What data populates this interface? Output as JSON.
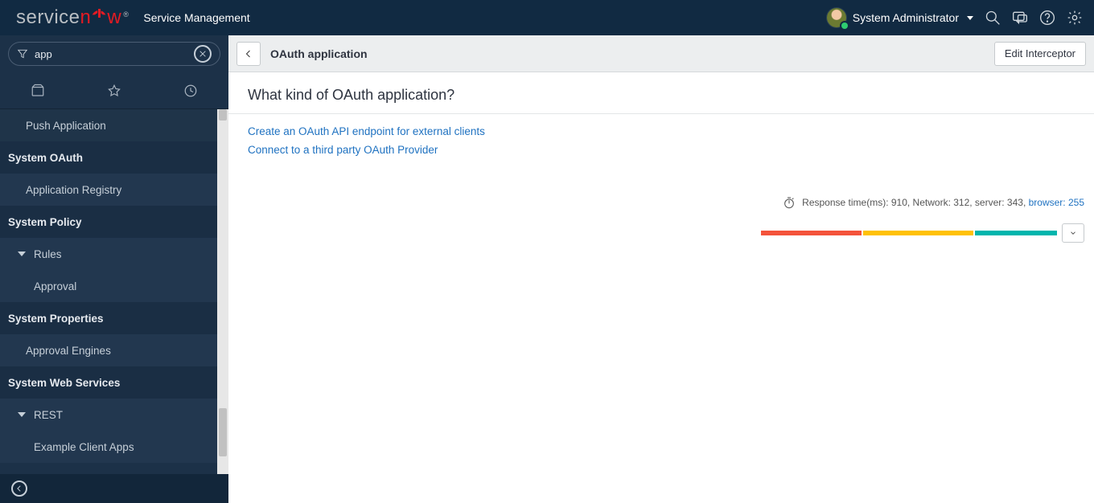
{
  "header": {
    "logo_part1": "service",
    "logo_part2": "n",
    "logo_part3": "w",
    "product": "Service Management",
    "user_name": "System Administrator"
  },
  "sidebar": {
    "filter_value": "app",
    "items": {
      "push_app": "Push Application",
      "system_oauth": "System OAuth",
      "application_registry": "Application Registry",
      "system_policy": "System Policy",
      "rules": "Rules",
      "approval": "Approval",
      "system_properties": "System Properties",
      "approval_engines": "Approval Engines",
      "system_web_services": "System Web Services",
      "rest": "REST",
      "example_client_apps": "Example Client Apps"
    }
  },
  "content": {
    "bar_title": "OAuth application",
    "edit_button": "Edit Interceptor",
    "question": "What kind of OAuth application?",
    "option1": "Create an OAuth API endpoint for external clients",
    "option2": "Connect to a third party OAuth Provider"
  },
  "response": {
    "prefix": "Response time(ms): 910, Network: 312, server: 343, ",
    "browser_label": "browser: 255",
    "segments": {
      "red": 312,
      "yellow": 343,
      "teal": 255,
      "total": 910
    }
  }
}
